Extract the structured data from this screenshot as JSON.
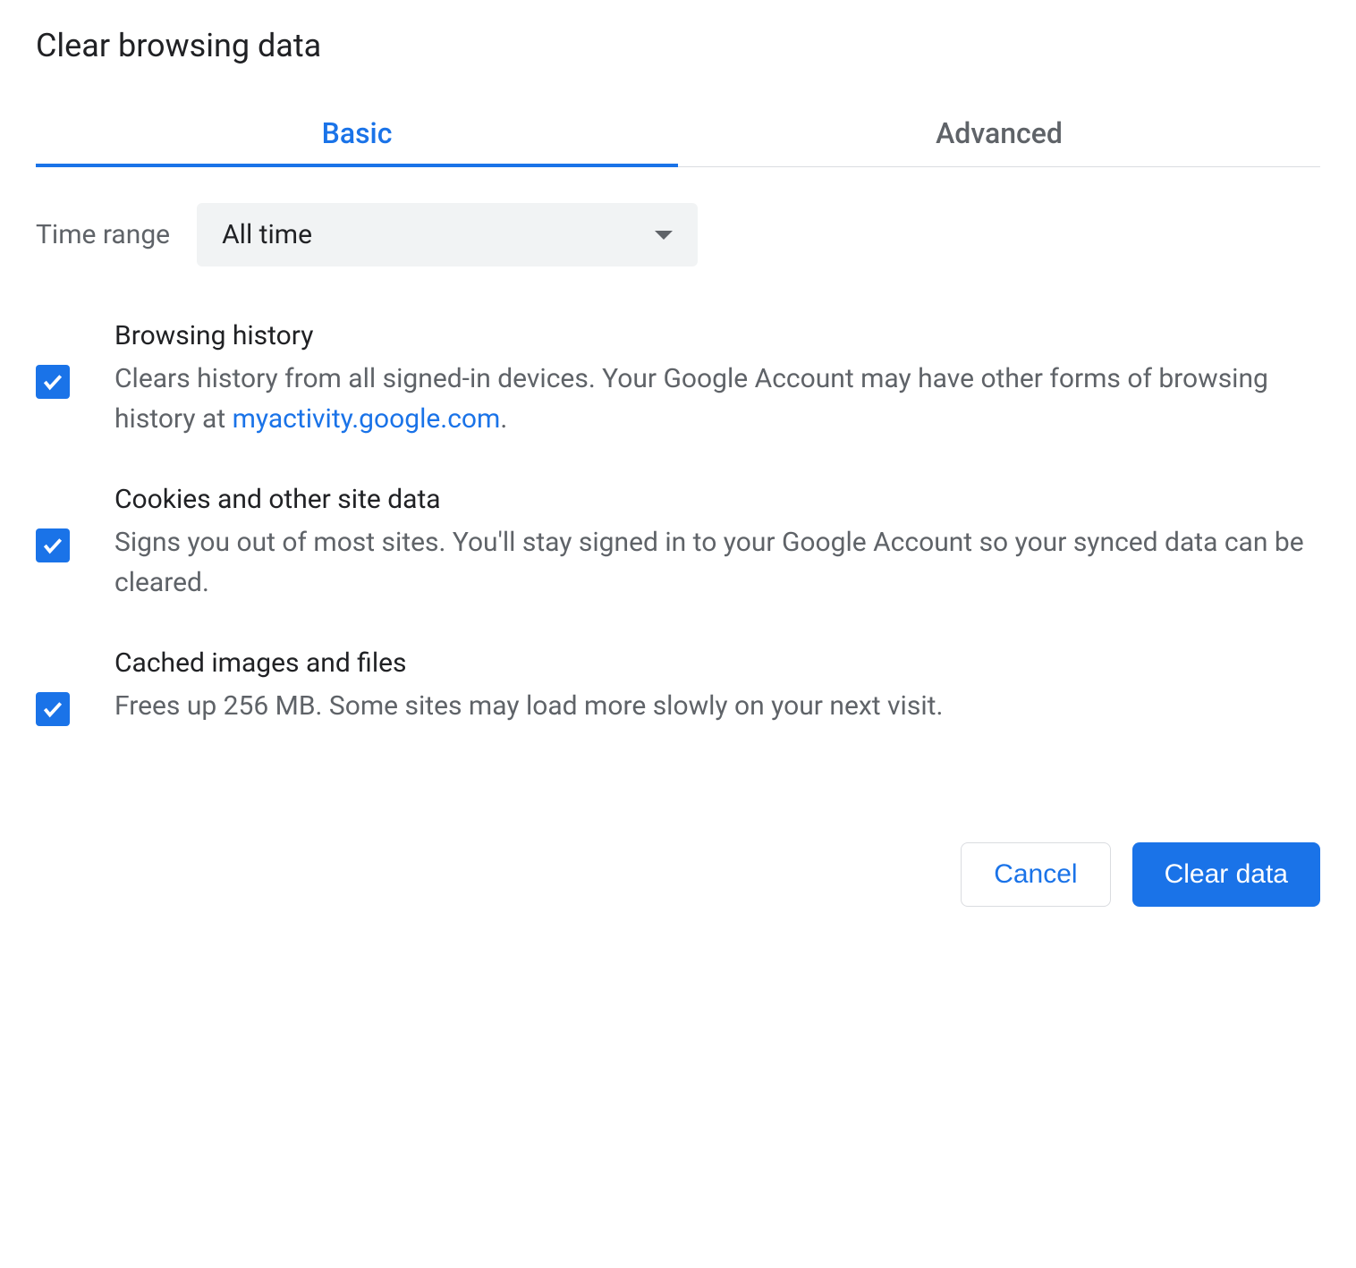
{
  "dialog": {
    "title": "Clear browsing data"
  },
  "tabs": {
    "basic": "Basic",
    "advanced": "Advanced"
  },
  "time_range": {
    "label": "Time range",
    "selected": "All time"
  },
  "options": {
    "browsing_history": {
      "title": "Browsing history",
      "description_pre": "Clears history from all signed-in devices. Your Google Account may have other forms of browsing history at ",
      "link": "myactivity.google.com",
      "description_post": "."
    },
    "cookies": {
      "title": "Cookies and other site data",
      "description": "Signs you out of most sites. You'll stay signed in to your Google Account so your synced data can be cleared."
    },
    "cache": {
      "title": "Cached images and files",
      "description": "Frees up 256 MB. Some sites may load more slowly on your next visit."
    }
  },
  "actions": {
    "cancel": "Cancel",
    "clear": "Clear data"
  }
}
